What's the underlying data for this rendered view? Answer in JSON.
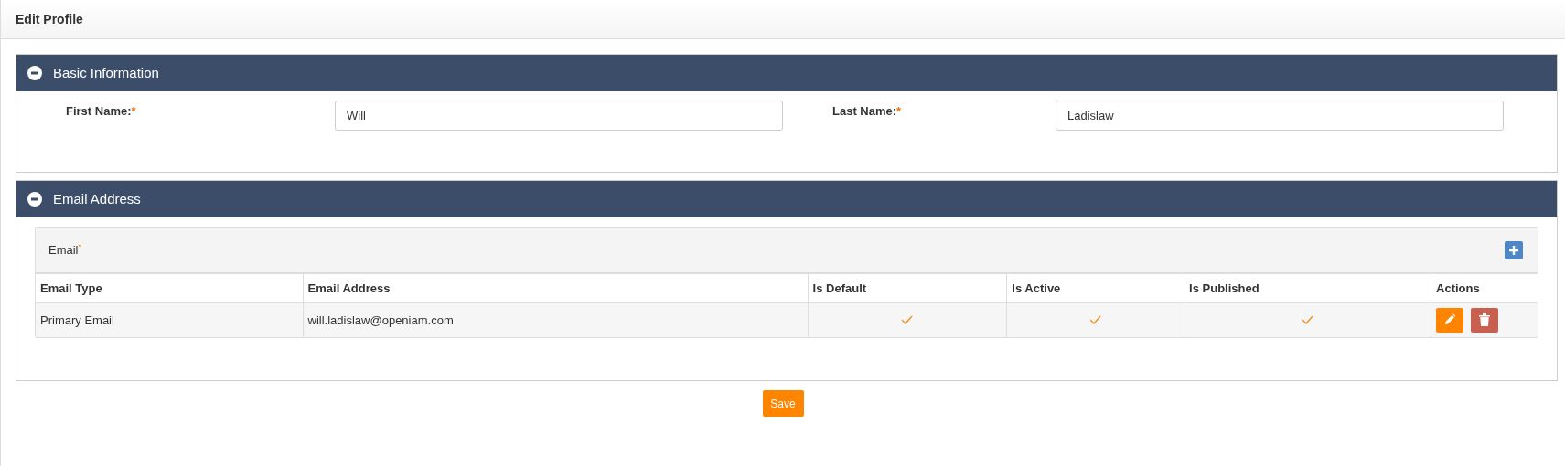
{
  "page_title": "Edit Profile",
  "basic_panel": {
    "title": "Basic Information",
    "expanded": true,
    "fields": [
      {
        "label": "First Name:",
        "required_mark": "*",
        "value": "Will"
      },
      {
        "label": "Last Name:",
        "required_mark": "*",
        "value": "Ladislaw"
      }
    ]
  },
  "email_panel": {
    "title": "Email Address",
    "expanded": true,
    "box_title": "Email",
    "required_mark": "*",
    "table": {
      "columns": [
        "Email Type",
        "Email Address",
        "Is Default",
        "Is Active",
        "Is Published",
        "Actions"
      ],
      "rows": [
        {
          "type": "Primary Email",
          "address": "will.ladislaw@openiam.com",
          "is_default": true,
          "is_active": true,
          "is_published": true
        }
      ]
    }
  },
  "save_button": "Save"
}
